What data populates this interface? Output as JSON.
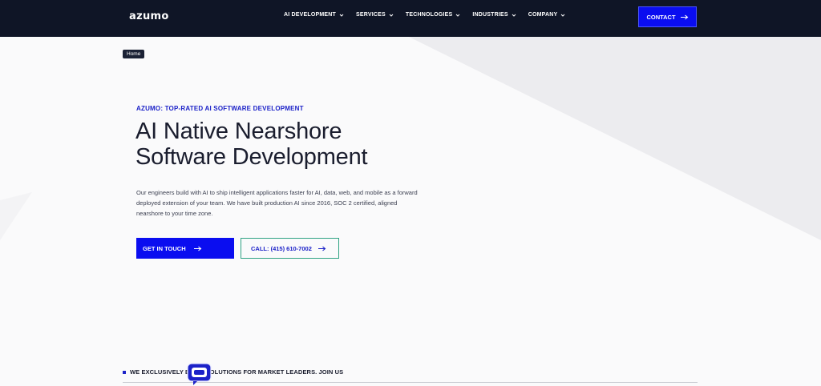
{
  "nav": {
    "logo": "azumo",
    "items": [
      {
        "label": "AI DEVELOPMENT"
      },
      {
        "label": "SERVICES"
      },
      {
        "label": "TECHNOLOGIES"
      },
      {
        "label": "INDUSTRIES"
      },
      {
        "label": "COMPANY"
      }
    ],
    "contact_label": "CONTACT"
  },
  "breadcrumb": "Home",
  "hero": {
    "eyebrow": "AZUMO: TOP-RATED AI SOFTWARE DEVELOPMENT",
    "title_line1": "AI Native Nearshore",
    "title_line2": "Software Development",
    "description": "Our engineers build with AI to ship intelligent applications faster for AI, data, web, and mobile as a forward deployed extension of your team. We have built production AI since 2016, SOC 2 certified, aligned nearshore to your time zone.",
    "primary_button": "GET IN TOUCH",
    "secondary_button": "CALL: (415) 610-7002"
  },
  "ticker": {
    "text": "WE EXCLUSIVELY BUILD SOLUTIONS FOR MARKET LEADERS. JOIN US"
  },
  "colors": {
    "nav_bg": "#0f1526",
    "accent_blue": "#0a0df0",
    "eyebrow_blue": "#1c22c8",
    "outline_green": "#2fa383"
  },
  "icons": {
    "chevron": "chevron-down-icon",
    "arrow": "arrow-right-icon",
    "chat": "chat-bubble-icon"
  }
}
